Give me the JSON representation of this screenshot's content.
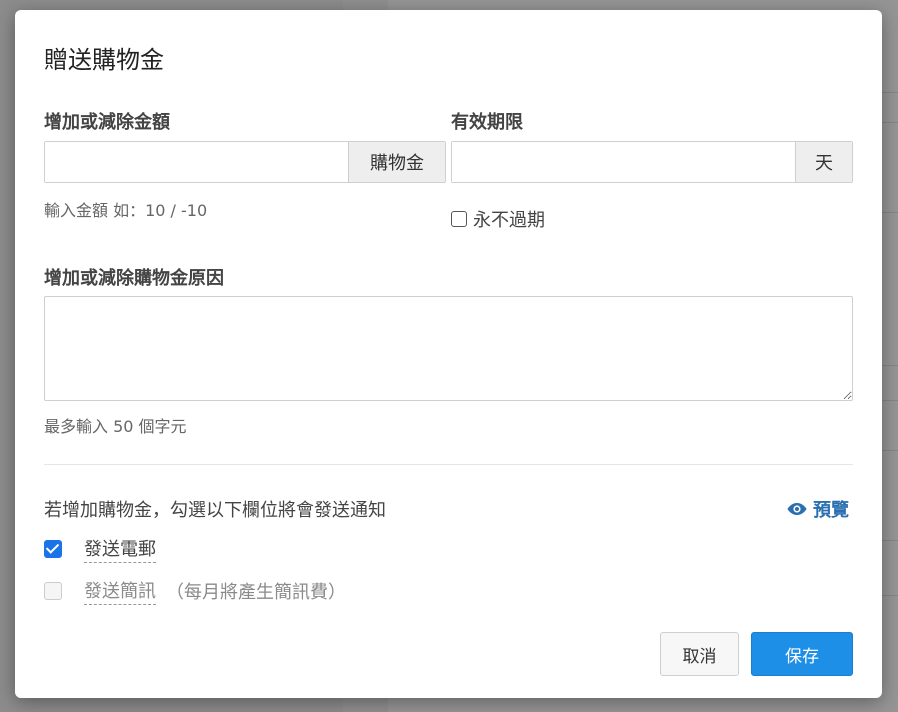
{
  "modal": {
    "title": "贈送購物金",
    "amount": {
      "label": "增加或減除金額",
      "value": "",
      "addon": "購物金",
      "hint": "輸入金額 如：10 / -10"
    },
    "expiry": {
      "label": "有效期限",
      "value": "",
      "addon": "天",
      "never_expire_label": "永不過期",
      "never_expire_checked": false
    },
    "reason": {
      "label": "增加或減除購物金原因",
      "value": "",
      "hint": "最多輸入 50 個字元"
    },
    "notify": {
      "text": "若增加購物金，勾選以下欄位將會發送通知",
      "preview_label": "預覽",
      "email_label": "發送電郵",
      "email_checked": true,
      "sms_label": "發送簡訊",
      "sms_note": "（每月將產生簡訊費）",
      "sms_checked": false
    },
    "buttons": {
      "cancel": "取消",
      "save": "保存"
    }
  },
  "colors": {
    "primary": "#1e8fe6",
    "link": "#2a6fb0",
    "checkbox": "#1a73e8"
  }
}
